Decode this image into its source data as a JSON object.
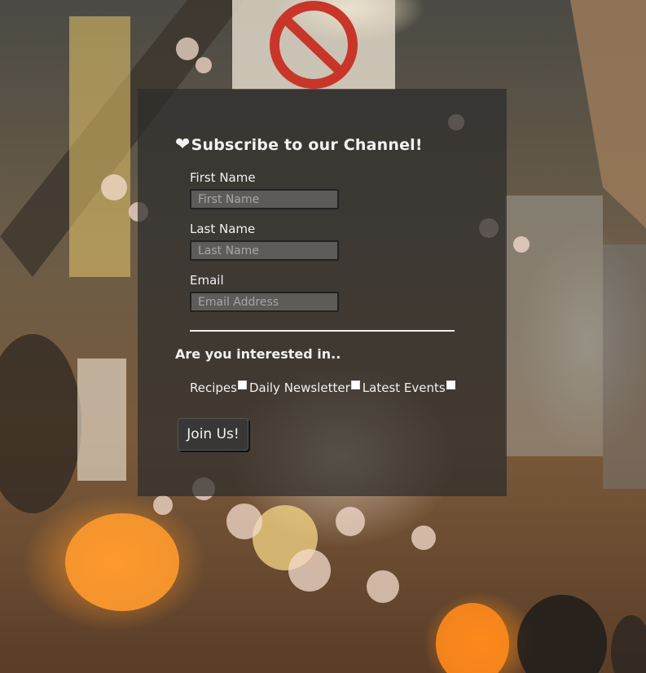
{
  "form": {
    "heart_glyph": "❤",
    "title": "Subscribe to our Channel!",
    "first_name": {
      "label": "First Name",
      "placeholder": "First Name",
      "value": ""
    },
    "last_name": {
      "label": "Last Name",
      "placeholder": "Last Name",
      "value": ""
    },
    "email": {
      "label": "Email",
      "placeholder": "Email Address",
      "value": ""
    },
    "interests_title": "Are you interested in..",
    "interests": [
      {
        "label": "Recipes",
        "checked": false
      },
      {
        "label": "Daily Newsletter",
        "checked": false
      },
      {
        "label": "Latest Events",
        "checked": false
      }
    ],
    "submit_label": "Join Us!"
  },
  "colors": {
    "card_bg": "#2d2d2d",
    "text": "#f2f2f2",
    "lantern_orange": "#ff9628"
  }
}
